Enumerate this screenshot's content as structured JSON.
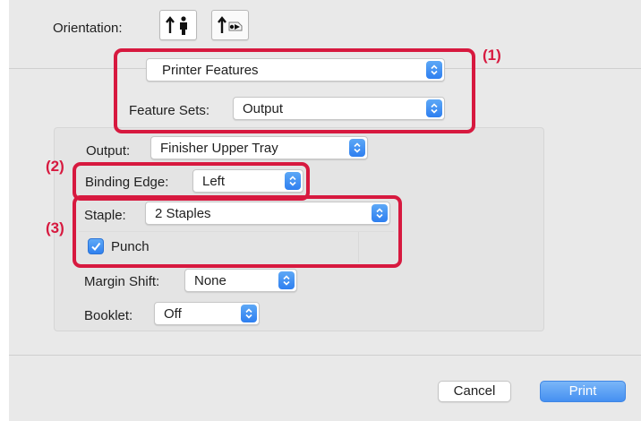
{
  "orientation": {
    "label": "Orientation:",
    "options": [
      {
        "name": "portrait",
        "selected": true
      },
      {
        "name": "landscape",
        "selected": false
      }
    ]
  },
  "panel_menu": {
    "selected": "Printer Features"
  },
  "feature_sets": {
    "label": "Feature Sets:",
    "selected": "Output"
  },
  "output": {
    "label": "Output:",
    "selected": "Finisher Upper Tray"
  },
  "binding_edge": {
    "label": "Binding Edge:",
    "selected": "Left"
  },
  "staple": {
    "label": "Staple:",
    "selected": "2 Staples"
  },
  "punch": {
    "label": "Punch",
    "checked": true
  },
  "margin_shift": {
    "label": "Margin Shift:",
    "selected": "None"
  },
  "booklet": {
    "label": "Booklet:",
    "selected": "Off"
  },
  "buttons": {
    "cancel": "Cancel",
    "print": "Print"
  },
  "callouts": {
    "one": "(1)",
    "two": "(2)",
    "three": "(3)"
  },
  "colors": {
    "accent": "#2f80ef",
    "callout": "#d7193f"
  },
  "icons": {
    "popup_arrows": "chevron-up-down-icon",
    "portrait": "portrait-orientation-icon",
    "landscape": "landscape-orientation-icon",
    "check": "checkmark-icon"
  }
}
